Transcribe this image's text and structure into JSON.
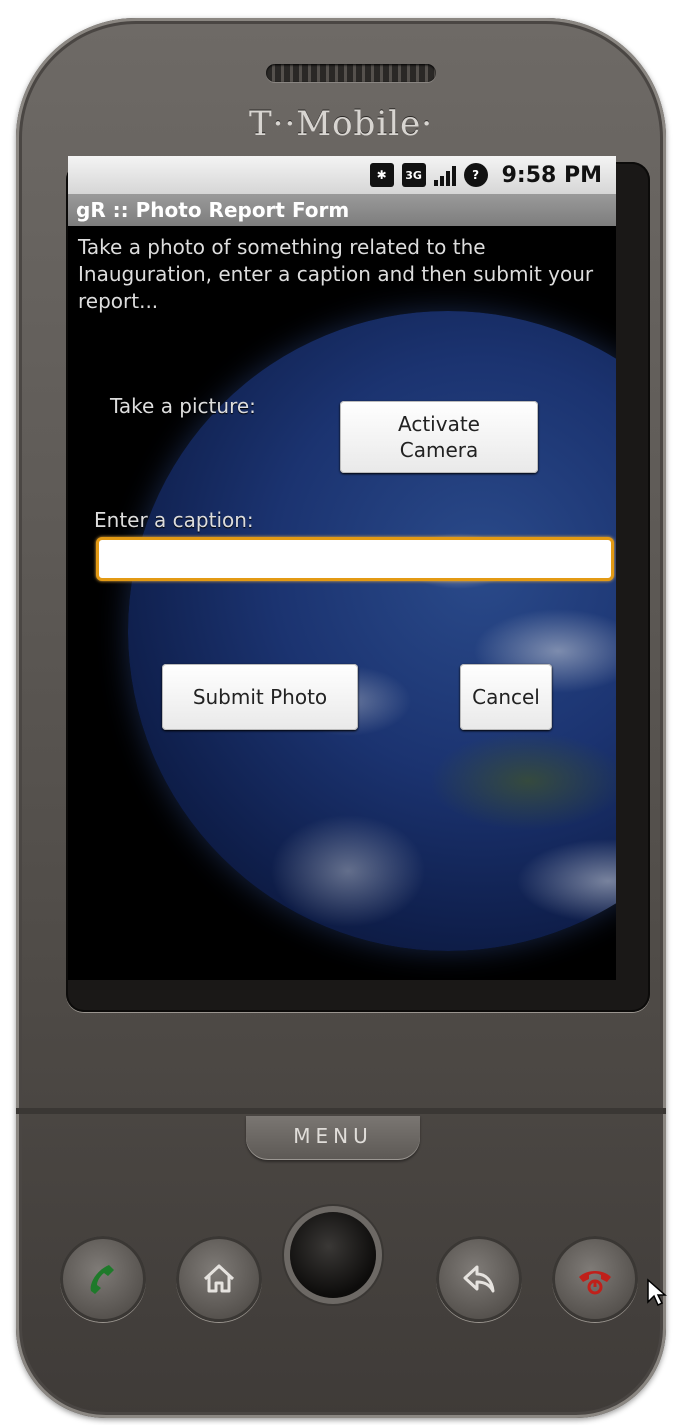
{
  "device": {
    "brand": "T··Mobile·",
    "menu_label": "MENU"
  },
  "statusbar": {
    "time": "9:58 PM",
    "icons": [
      "bluetooth-icon",
      "3g-icon",
      "signal-icon",
      "alert-icon"
    ],
    "network_label": "3G"
  },
  "app": {
    "title": "gR :: Photo Report Form",
    "intro_text": "Take a photo of something related to the Inauguration, enter a caption and then submit your report...",
    "take_picture_label": "Take a picture:",
    "activate_camera_label": "Activate\nCamera",
    "caption_label": "Enter a caption:",
    "caption_value": "",
    "submit_label": "Submit Photo",
    "cancel_label": "Cancel"
  },
  "colors": {
    "focus_border": "#e39a14",
    "call_green": "#1e7a2a",
    "end_red": "#c0201a"
  }
}
